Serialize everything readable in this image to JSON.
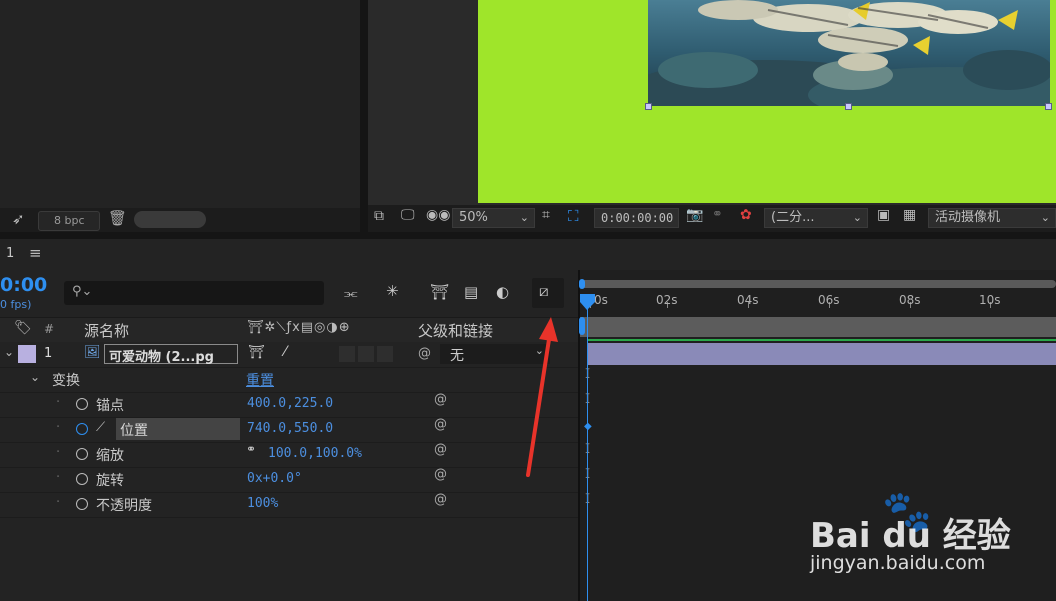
{
  "project_panel": {
    "bpc_label": "8 bpc"
  },
  "viewer": {
    "zoom": "50%",
    "timecode": "0:00:00:00",
    "resolution": "(二分...",
    "camera": "活动摄像机"
  },
  "timeline": {
    "tab_label": "1",
    "menu_icon": "≡",
    "current_time": "0:00",
    "fps": "0 fps)",
    "search_placeholder": ""
  },
  "columns": {
    "num": "#",
    "source_name": "源名称",
    "parent_link": "父级和链接"
  },
  "layer": {
    "index": "1",
    "name": "可爱动物 (2...pg",
    "parent": "无"
  },
  "transform": {
    "label": "变换",
    "reset": "重置",
    "properties": [
      {
        "name": "锚点",
        "value": "400.0,225.0"
      },
      {
        "name": "位置",
        "value": "740.0,550.0"
      },
      {
        "name": "缩放",
        "value": "100.0,100.0%"
      },
      {
        "name": "旋转",
        "value": "0x+0.0°"
      },
      {
        "name": "不透明度",
        "value": "100%"
      }
    ]
  },
  "ruler": {
    "labels": [
      "0s",
      "02s",
      "04s",
      "06s",
      "08s",
      "10s"
    ]
  },
  "colors": {
    "canvas_green": "#9fe52a",
    "accent_blue": "#2e8ff0",
    "layer_label": "#b8b0e0",
    "layer_bar": "#8a8ab8",
    "arrow_red": "#e8332a"
  },
  "watermark": {
    "brand": "Bai du 经验",
    "url": "jingyan.baidu.com"
  }
}
